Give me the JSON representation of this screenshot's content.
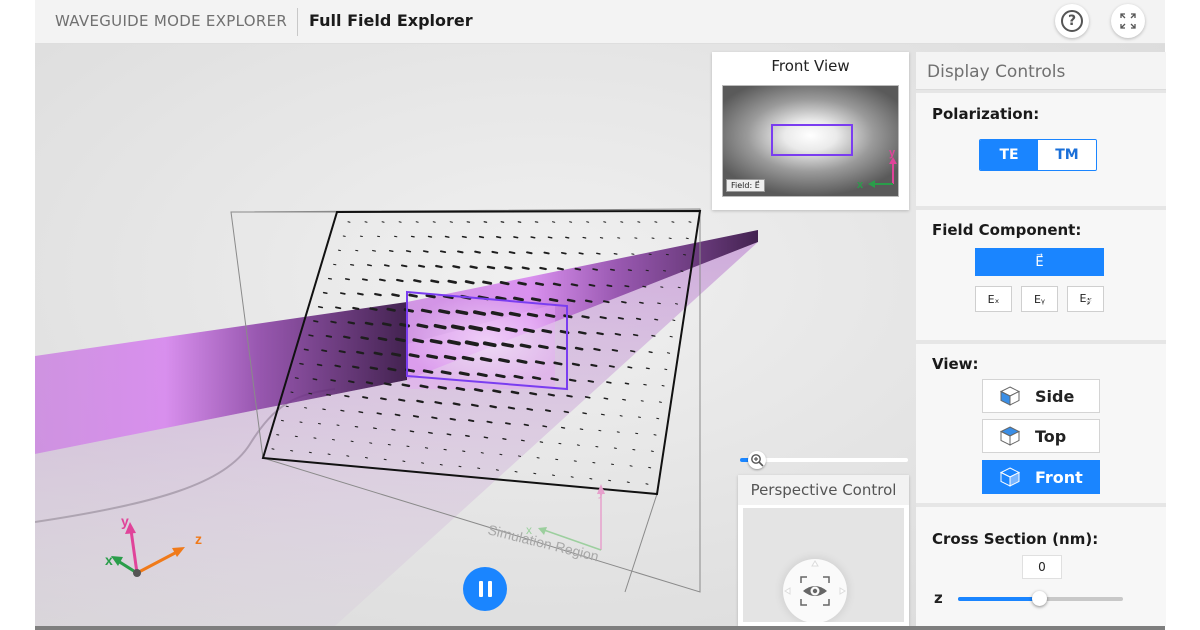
{
  "header": {
    "app_name": "WAVEGUIDE MODE EXPLORER",
    "page_title": "Full Field Explorer",
    "help_glyph": "?"
  },
  "front_view": {
    "title": "Front View",
    "field_label": "Field: E⃗",
    "axis_x": "x",
    "axis_y": "y"
  },
  "scene": {
    "region_label": "Simulation Region",
    "axis_x": "x",
    "axis_y": "y",
    "axis_z": "z",
    "paused": false
  },
  "perspective": {
    "title": "Perspective Control"
  },
  "zoom": {
    "level": 0.03
  },
  "controls": {
    "title": "Display Controls",
    "polarization": {
      "label": "Polarization:",
      "options": [
        "TE",
        "TM"
      ],
      "selected": "TE"
    },
    "field_component": {
      "label": "Field Component:",
      "vector_option": "E⃗",
      "components": [
        "Eₓ",
        "Eᵧ",
        "E𝓏"
      ],
      "selected": "E⃗"
    },
    "view": {
      "label": "View:",
      "options": [
        "Side",
        "Top",
        "Front"
      ],
      "selected": "Front"
    },
    "cross_section": {
      "label": "Cross Section (nm):",
      "axis": "z",
      "value": "0",
      "position": 0.49
    }
  },
  "colors": {
    "accent": "#1a85ff",
    "beam": "#b44bd6",
    "core_outline": "#7a3df0",
    "axis_x": "#2a9d4a",
    "axis_y": "#e0449a",
    "axis_z": "#f07a1a"
  },
  "icons": {
    "help": "question-circle-icon",
    "fullscreen": "expand-corners-icon",
    "zoom": "zoom-in-icon",
    "view": "cube-icon",
    "perspective": "eye-icon",
    "pause": "pause-icon"
  }
}
